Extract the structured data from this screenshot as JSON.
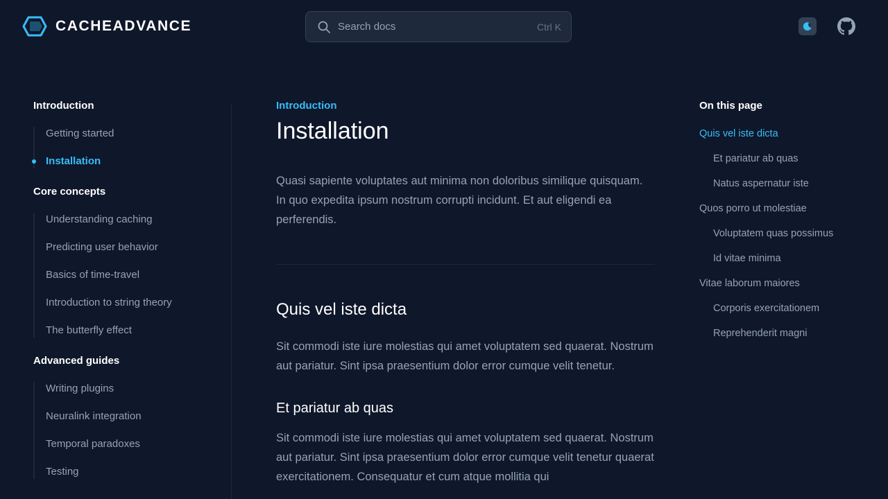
{
  "header": {
    "logo_text": "CACHEADVANCE",
    "search": {
      "placeholder": "Search docs",
      "shortcut": "Ctrl K"
    }
  },
  "sidebar": {
    "groups": [
      {
        "title": "Introduction",
        "items": [
          {
            "label": "Getting started"
          },
          {
            "label": "Installation",
            "active": true
          }
        ]
      },
      {
        "title": "Core concepts",
        "items": [
          {
            "label": "Understanding caching"
          },
          {
            "label": "Predicting user behavior"
          },
          {
            "label": "Basics of time-travel"
          },
          {
            "label": "Introduction to string theory"
          },
          {
            "label": "The butterfly effect"
          }
        ]
      },
      {
        "title": "Advanced guides",
        "items": [
          {
            "label": "Writing plugins"
          },
          {
            "label": "Neuralink integration"
          },
          {
            "label": "Temporal paradoxes"
          },
          {
            "label": "Testing"
          }
        ]
      }
    ]
  },
  "main": {
    "eyebrow": "Introduction",
    "title": "Installation",
    "lead": "Quasi sapiente voluptates aut minima non doloribus similique quisquam. In quo expedita ipsum nostrum corrupti incidunt. Et aut eligendi ea perferendis.",
    "section1": {
      "heading": "Quis vel iste dicta",
      "body": "Sit commodi iste iure molestias qui amet voluptatem sed quaerat. Nostrum aut pariatur. Sint ipsa praesentium dolor error cumque velit tenetur."
    },
    "section2": {
      "heading": "Et pariatur ab quas",
      "body": "Sit commodi iste iure molestias qui amet voluptatem sed quaerat. Nostrum aut pariatur. Sint ipsa praesentium dolor error cumque velit tenetur quaerat exercitationem. Consequatur et cum atque mollitia qui"
    }
  },
  "toc": {
    "title": "On this page",
    "items": [
      {
        "label": "Quis vel iste dicta",
        "level": 1,
        "active": true
      },
      {
        "label": "Et pariatur ab quas",
        "level": 2
      },
      {
        "label": "Natus aspernatur iste",
        "level": 2
      },
      {
        "label": "Quos porro ut molestiae",
        "level": 1
      },
      {
        "label": "Voluptatem quas possimus",
        "level": 2
      },
      {
        "label": "Id vitae minima",
        "level": 2
      },
      {
        "label": "Vitae laborum maiores",
        "level": 1
      },
      {
        "label": "Corporis exercitationem",
        "level": 2
      },
      {
        "label": "Reprehenderit magni",
        "level": 2
      }
    ]
  },
  "colors": {
    "background": "#0f172a",
    "accent": "#38bdf8",
    "heading": "#ffffff",
    "text": "#94a3b8"
  },
  "icons": [
    "logo-icon",
    "search-icon",
    "theme-toggle-icon",
    "github-icon"
  ]
}
